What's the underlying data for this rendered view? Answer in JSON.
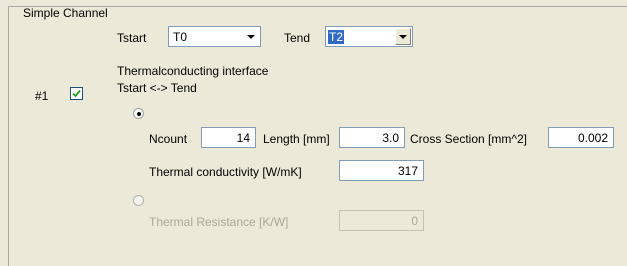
{
  "group": {
    "title": "Simple Channel"
  },
  "channel": {
    "tstart_label": "Tstart",
    "tstart_value": "T0",
    "tend_label": "Tend",
    "tend_value": "T2"
  },
  "interface": {
    "index_label": "#1",
    "enabled": true,
    "heading": "Thermalconducting interface",
    "sub_heading": "Tstart <-> Tend"
  },
  "params": {
    "ncount_label": "Ncount",
    "ncount_value": "14",
    "length_label": "Length [mm]",
    "length_value": "3.0",
    "cross_section_label": "Cross Section [mm^2]",
    "cross_section_value": "0.002",
    "conductivity_label": "Thermal conductivity [W/mK]",
    "conductivity_value": "317",
    "resistance_label": "Thermal Resistance [K/W]",
    "resistance_value": "0"
  }
}
